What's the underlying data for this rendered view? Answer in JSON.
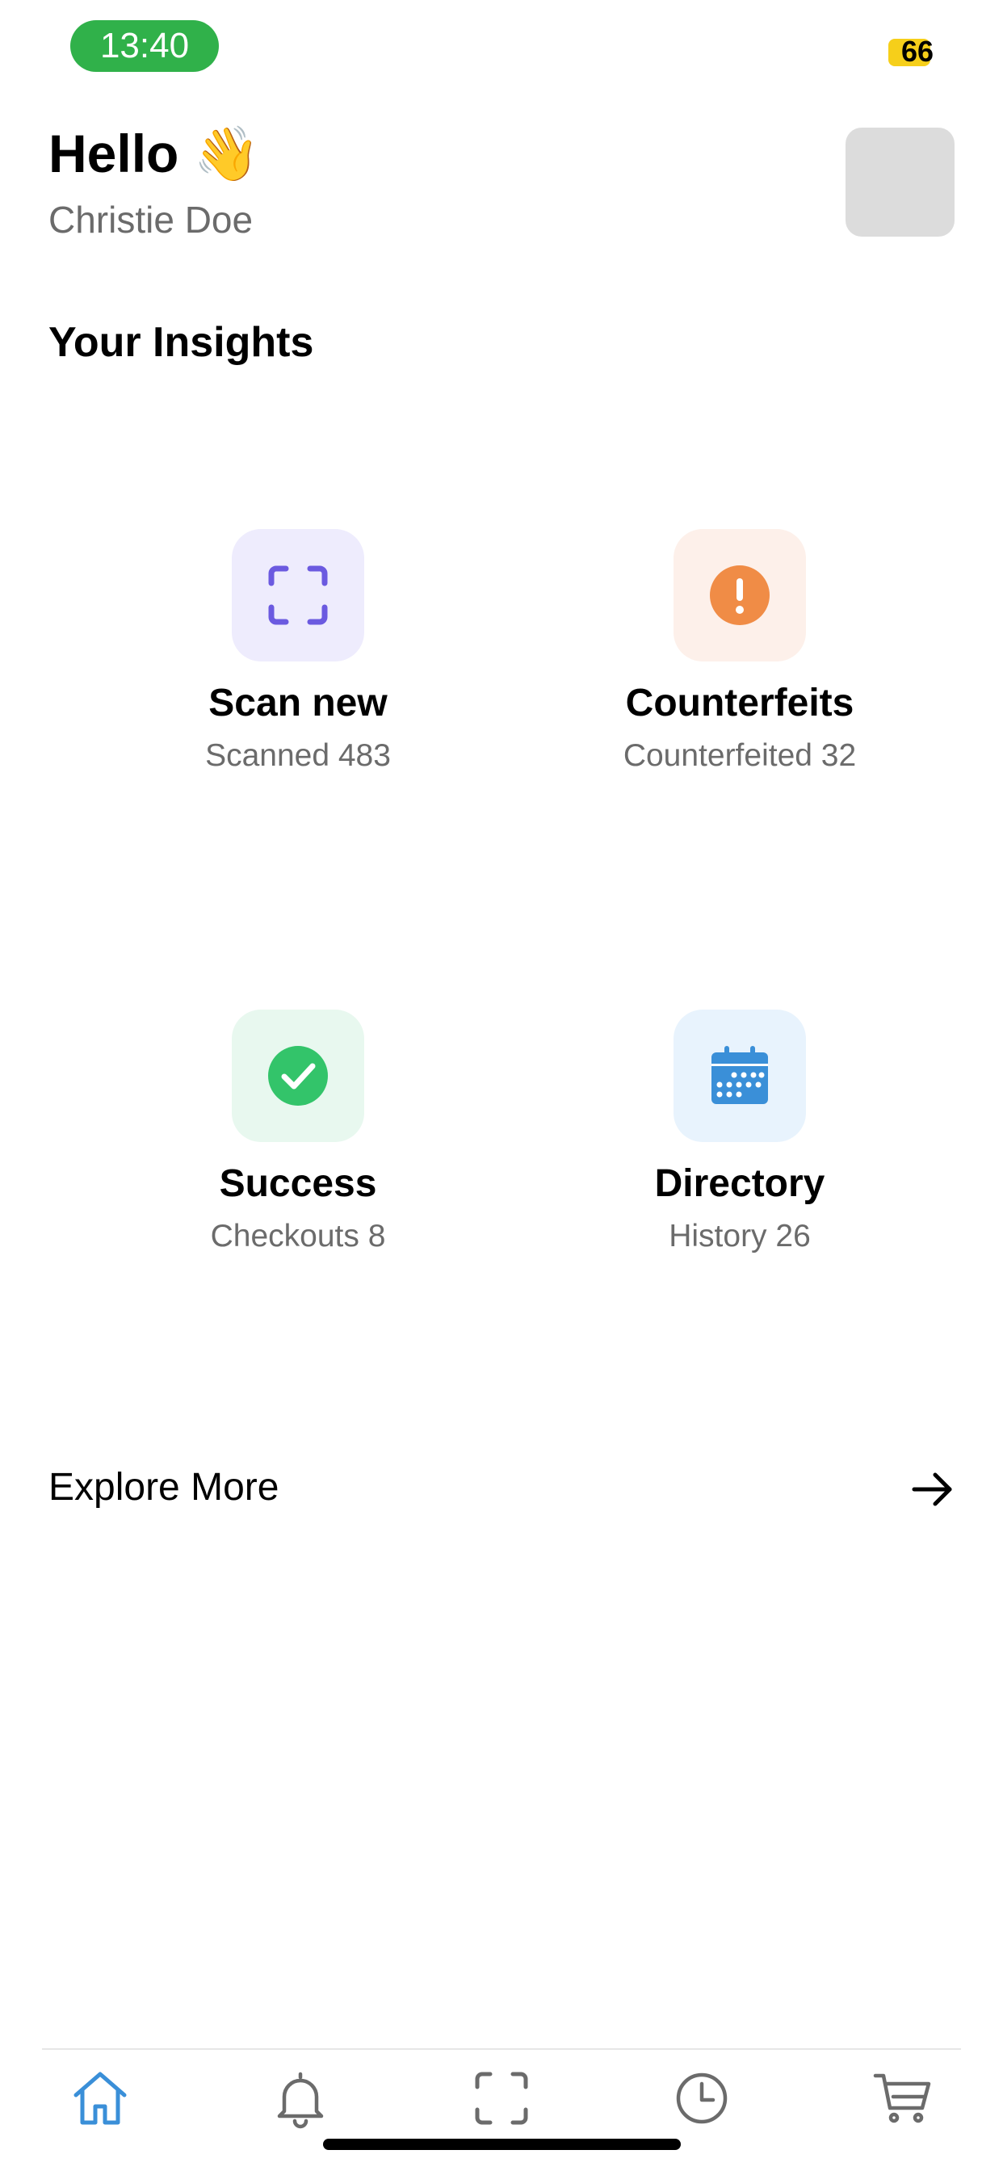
{
  "status_bar": {
    "time": "13:40",
    "battery": "66"
  },
  "header": {
    "greeting": "Hello",
    "greeting_emoji": "👋",
    "user_name": "Christie Doe"
  },
  "insights": {
    "title": "Your Insights",
    "cards": [
      {
        "title": "Scan new",
        "subtitle": "Scanned 483",
        "icon": "scan-icon",
        "tile_color": "#eeecfd",
        "icon_color": "#6b5ae0"
      },
      {
        "title": "Counterfeits",
        "subtitle": "Counterfeited 32",
        "icon": "alert-icon",
        "tile_color": "#fdf0ea",
        "icon_color": "#f08c46"
      },
      {
        "title": "Success",
        "subtitle": "Checkouts 8",
        "icon": "check-circle-icon",
        "tile_color": "#e8f8ef",
        "icon_color": "#33c46a"
      },
      {
        "title": "Directory",
        "subtitle": "History 26",
        "icon": "calendar-icon",
        "tile_color": "#e8f3fd",
        "icon_color": "#3a8fd8"
      }
    ]
  },
  "explore": {
    "label": "Explore More"
  },
  "tab_bar": {
    "tabs": [
      {
        "name": "home",
        "icon": "home-icon",
        "active": true
      },
      {
        "name": "notifications",
        "icon": "bell-icon",
        "active": false
      },
      {
        "name": "scan",
        "icon": "scan-icon",
        "active": false
      },
      {
        "name": "history",
        "icon": "clock-icon",
        "active": false
      },
      {
        "name": "cart",
        "icon": "cart-icon",
        "active": false
      }
    ],
    "active_color": "#3a8fd8",
    "inactive_color": "#6b6b6b"
  }
}
